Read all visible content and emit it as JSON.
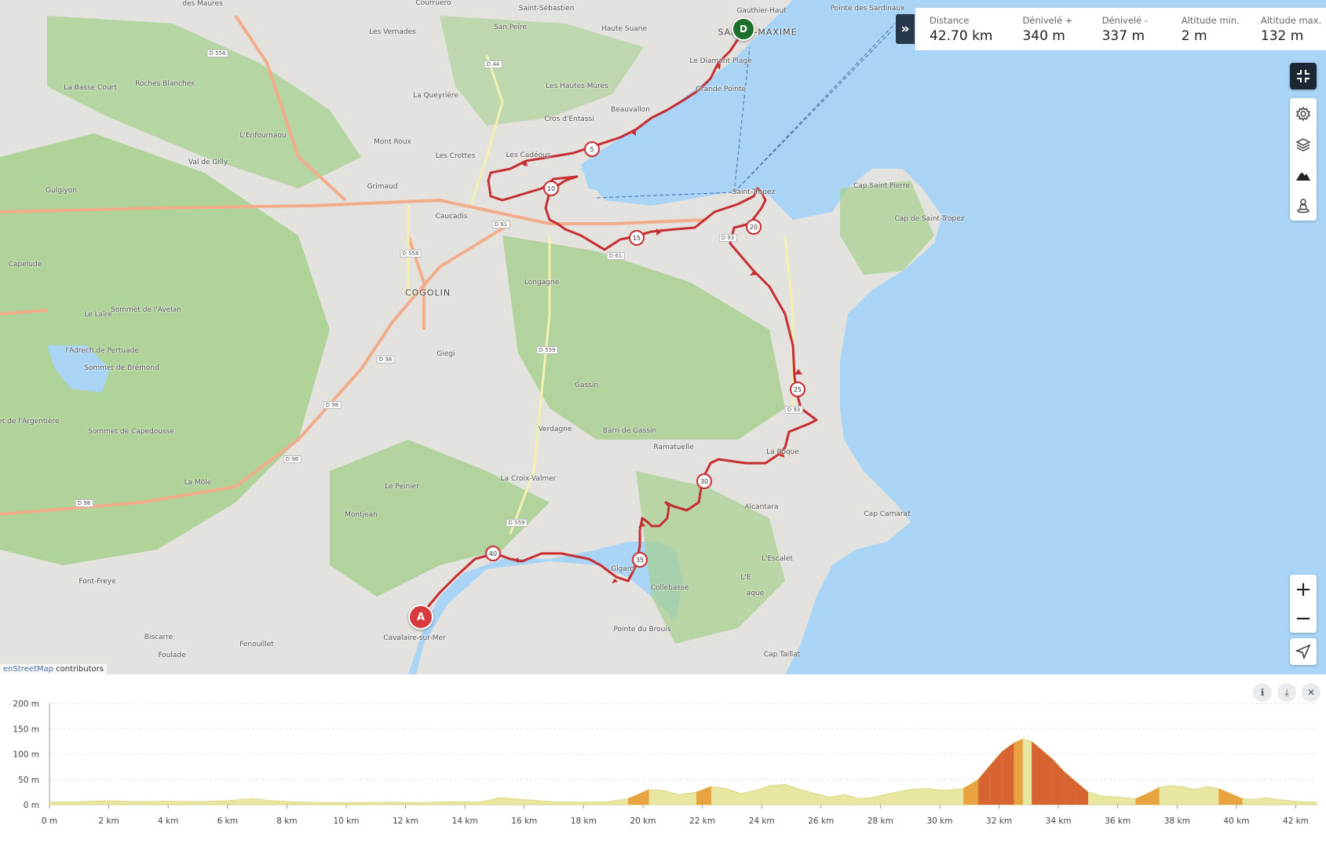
{
  "map": {
    "places": [
      {
        "name": "Courruero"
      },
      {
        "name": "Saint-Sébastien"
      },
      {
        "name": "Gauthier-Haut"
      },
      {
        "name": "Pointe des Sardinaux"
      },
      {
        "name": "SAINTE-MAXIME",
        "town": true
      },
      {
        "name": "Les Vernades"
      },
      {
        "name": "San Peïre"
      },
      {
        "name": "Haute Suane"
      },
      {
        "name": "Le Diamant Plage"
      },
      {
        "name": "La Basse Court"
      },
      {
        "name": "Roches Blanches"
      },
      {
        "name": "La Queyrière"
      },
      {
        "name": "Les Hautes Mûres"
      },
      {
        "name": "Grande Pointe"
      },
      {
        "name": "L'Enfournaou"
      },
      {
        "name": "Beauvallon"
      },
      {
        "name": "Cros d'Entassi"
      },
      {
        "name": "Mont Roux"
      },
      {
        "name": "Val de Gilly"
      },
      {
        "name": "Les Crottes"
      },
      {
        "name": "Les Cadéous"
      },
      {
        "name": "Gulgiyon"
      },
      {
        "name": "Grimaud"
      },
      {
        "name": "Cap Saint Pierre"
      },
      {
        "name": "Saint-Tropez"
      },
      {
        "name": "Caucadis"
      },
      {
        "name": "Cap de Saint-Tropez"
      },
      {
        "name": "Capelude"
      },
      {
        "name": "COGOLIN",
        "town": true
      },
      {
        "name": "Longagne"
      },
      {
        "name": "Sommet de l'Avelan"
      },
      {
        "name": "Le Laïre"
      },
      {
        "name": "l'Adrech de Pertuade"
      },
      {
        "name": "Giegi"
      },
      {
        "name": "Sommet de Brémond"
      },
      {
        "name": "Gassin"
      },
      {
        "name": "Sommet de l'Argentière"
      },
      {
        "name": "Sommet de Capedousse"
      },
      {
        "name": "Verdagne"
      },
      {
        "name": "Barri de Gassin"
      },
      {
        "name": "Ramatuelle"
      },
      {
        "name": "La Croix-Valmer"
      },
      {
        "name": "La Môle"
      },
      {
        "name": "Le Peinier"
      },
      {
        "name": "La Roque"
      },
      {
        "name": "Alcantara"
      },
      {
        "name": "Montjean"
      },
      {
        "name": "Cap Camarat"
      },
      {
        "name": "L'Escalet"
      },
      {
        "name": "Gigaro"
      },
      {
        "name": "Font-Freye"
      },
      {
        "name": "Collebasse"
      },
      {
        "name": "L'E"
      },
      {
        "name": "aque"
      },
      {
        "name": "Pointe du Brouis"
      },
      {
        "name": "Cavalaire-sur-Mer"
      },
      {
        "name": "Biscarre"
      },
      {
        "name": "Fenouillet"
      },
      {
        "name": "Foulade"
      },
      {
        "name": "Cap Taillat"
      },
      {
        "name": "des Maures"
      }
    ],
    "road_labels": [
      "D 558",
      "D 44",
      "D 61",
      "D 558",
      "D 559",
      "D 98",
      "D 98",
      "D 98",
      "D 98",
      "D 93",
      "D 93",
      "D 559",
      "D 61"
    ],
    "km_markers": [
      "5",
      "10",
      "15",
      "20",
      "25",
      "30",
      "35",
      "40"
    ],
    "start_marker": "A",
    "end_marker": "D",
    "attribution_prefix": "enStreetMap",
    "attribution_suffix": " contributors",
    "route_color": "#c62e32",
    "water_color": "#a9d4f5",
    "land_color": "#e4e2de",
    "forest_color": "#a6d08d"
  },
  "stats": [
    {
      "label": "Distance",
      "value": "42.70 km"
    },
    {
      "label": "Dénivelé +",
      "value": "340 m"
    },
    {
      "label": "Dénivelé -",
      "value": "337 m"
    },
    {
      "label": "Altitude min.",
      "value": "2 m"
    },
    {
      "label": "Altitude max.",
      "value": "132 m"
    }
  ],
  "toolbar": {
    "collapse_icon": "double-chevron-right-icon",
    "fullscreen_icon": "exit-fullscreen-icon",
    "settings_icon": "gear-icon",
    "layers_icon": "layers-icon",
    "terrain_icon": "mountain-icon",
    "pegman_icon": "street-view-icon",
    "zoom_in": "+",
    "zoom_out": "−",
    "locate_icon": "locate-arrow-icon"
  },
  "chart_data": {
    "type": "area",
    "title": "",
    "xlabel": "",
    "ylabel": "",
    "y_ticks": [
      "0 m",
      "50 m",
      "100 m",
      "150 m",
      "200 m"
    ],
    "x_ticks": [
      "0 m",
      "2 km",
      "4 km",
      "6 km",
      "8 km",
      "10 km",
      "12 km",
      "14 km",
      "16 km",
      "18 km",
      "20 km",
      "22 km",
      "24 km",
      "26 km",
      "28 km",
      "30 km",
      "32 km",
      "34 km",
      "36 km",
      "38 km",
      "40 km",
      "42 km"
    ],
    "xlim": [
      0,
      42.7
    ],
    "ylim": [
      0,
      200
    ],
    "grid": true,
    "series": [
      {
        "x": [
          0,
          1,
          2,
          3,
          4,
          5,
          6,
          6.8,
          7.5,
          8.5,
          9.5,
          10.5,
          11.5,
          12.5,
          13.5,
          14.5,
          15.2,
          16,
          17,
          18,
          18.8,
          19.5,
          20.2,
          20.7,
          21.2,
          21.8,
          22.3,
          22.8,
          23.3,
          23.8,
          24.3,
          24.8,
          25.3,
          25.8,
          26.3,
          26.8,
          27.3,
          27.8,
          28.3,
          29,
          29.6,
          30.2,
          30.8,
          31.3,
          31.7,
          32.1,
          32.5,
          32.8,
          33.1,
          33.4,
          33.8,
          34.2,
          34.6,
          35,
          35.4,
          35.8,
          36.2,
          36.6,
          37,
          37.4,
          37.8,
          38.2,
          38.6,
          39,
          39.4,
          39.8,
          40.2,
          40.6,
          41,
          41.4,
          41.8,
          42.2,
          42.7
        ],
        "y": [
          5,
          6,
          8,
          6,
          7,
          6,
          8,
          12,
          8,
          5,
          4,
          4,
          5,
          4,
          6,
          5,
          14,
          10,
          6,
          5,
          6,
          12,
          30,
          28,
          20,
          25,
          36,
          32,
          22,
          28,
          38,
          40,
          30,
          22,
          15,
          20,
          12,
          15,
          22,
          30,
          32,
          28,
          32,
          50,
          78,
          105,
          122,
          130,
          125,
          110,
          90,
          65,
          45,
          25,
          18,
          16,
          14,
          12,
          22,
          34,
          38,
          35,
          30,
          36,
          32,
          22,
          12,
          10,
          14,
          10,
          8,
          6,
          5
        ]
      }
    ],
    "fill_color": "#e8e7a2",
    "steep_color": "#e8962e",
    "steepest_color": "#d44a1e"
  }
}
